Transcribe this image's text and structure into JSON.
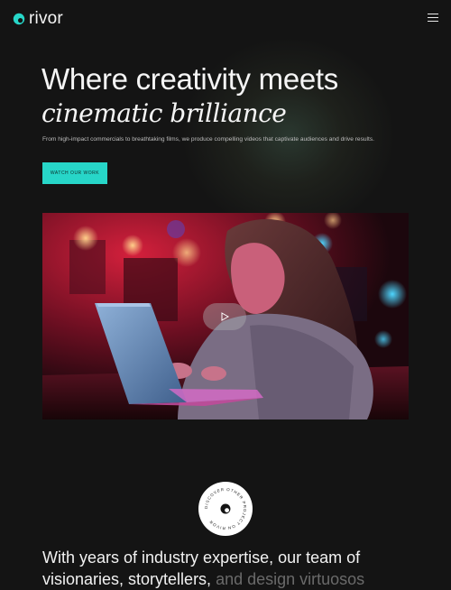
{
  "header": {
    "brand_name": "rivor",
    "logo_icon": "rivor-logo-icon",
    "menu_icon": "hamburger-menu-icon"
  },
  "hero": {
    "title_line_1": "Where creativity meets",
    "title_line_2": "cinematic brilliance",
    "subtitle": "From high-impact commercials to breathtaking films, we produce compelling videos that captivate audiences and drive results.",
    "cta_label": "WATCH OUR WORK"
  },
  "video": {
    "play_icon": "play-icon",
    "description": ""
  },
  "badge": {
    "ring_text": "DISCOVER OTHER PROJECT ON RIVOR",
    "center_icon": "rivor-logo-icon"
  },
  "about": {
    "text_bright_1": "With years of industry expertise, our team of",
    "text_bright_2": "visionaries, storytellers,",
    "text_muted": " and design virtuosos"
  },
  "colors": {
    "background": "#141414",
    "accent": "#27d6c8",
    "text": "#f2f2f2",
    "muted_text": "#6a6a6a"
  }
}
